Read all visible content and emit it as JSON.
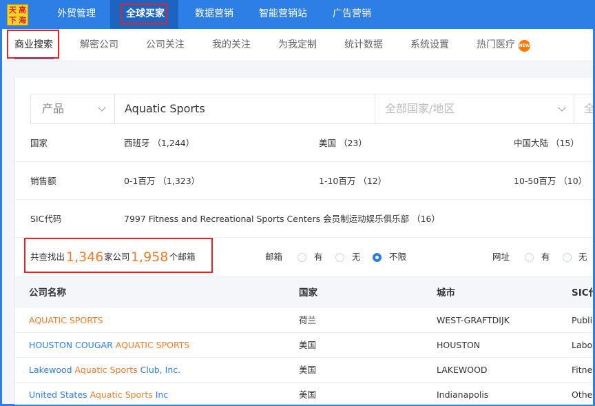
{
  "logo": {
    "chars": [
      "天",
      "高",
      "下",
      "海"
    ]
  },
  "topnav": {
    "items": [
      "外贸管理",
      "全球买家",
      "数据营销",
      "智能营销站",
      "广告营销"
    ]
  },
  "subnav": {
    "items": [
      "商业搜索",
      "解密公司",
      "公司关注",
      "我的关注",
      "为我定制",
      "统计数据",
      "系统设置",
      "热门医疗"
    ],
    "hot_badge": "NEW"
  },
  "search": {
    "type_label": "产品",
    "query": "Aquatic Sports",
    "country_placeholder": "全部国家/地区",
    "extra": "全"
  },
  "filters": {
    "country": {
      "label": "国家",
      "options": [
        "西班牙 （1,244）",
        "美国 （23）",
        "中国大陆 （15）"
      ]
    },
    "sales": {
      "label": "销售额",
      "options": [
        "0-1百万 （1,323）",
        "1-10百万 （12）",
        "10-50百万 （10）"
      ]
    },
    "sic": {
      "label": "SIC代码",
      "options": [
        "7997 Fitness and Recreational Sports Centers 会员制运动娱乐俱乐部 （16）"
      ]
    }
  },
  "results": {
    "prefix": "共查找出",
    "companies": "1,346",
    "companies_unit": "家公司",
    "emails": "1,958",
    "emails_unit": "个邮箱",
    "email_filter": {
      "label": "邮箱",
      "options": [
        "有",
        "无",
        "不限"
      ],
      "selected": "不限"
    },
    "website_filter": {
      "label": "网址",
      "options": [
        "有",
        "无"
      ]
    }
  },
  "table": {
    "headers": [
      "公司名称",
      "国家",
      "城市",
      "SIC代"
    ],
    "rows": [
      {
        "name_pre": "",
        "name_hl": "AQUATIC SPORTS",
        "name_post": "",
        "country": "荷兰",
        "city": "WEST-GRAFTDIJK",
        "sic": "Publi"
      },
      {
        "name_pre": "HOUSTON COUGAR ",
        "name_hl": "AQUATIC SPORTS",
        "name_post": "",
        "country": "美国",
        "city": "HOUSTON",
        "sic": "Labo"
      },
      {
        "name_pre": "Lakewood ",
        "name_hl": "Aquatic Sports",
        "name_post": " Club, Inc.",
        "country": "美国",
        "city": "LAKEWOOD",
        "sic": "Fitne"
      },
      {
        "name_pre": "United States ",
        "name_hl": "Aquatic Sports",
        "name_post": " Inc",
        "country": "美国",
        "city": "Indianapolis",
        "sic": "Other"
      }
    ]
  },
  "colors": {
    "primary": "#2d7fe6",
    "accent": "#f07d2c",
    "highlight_box": "#e0232a"
  }
}
